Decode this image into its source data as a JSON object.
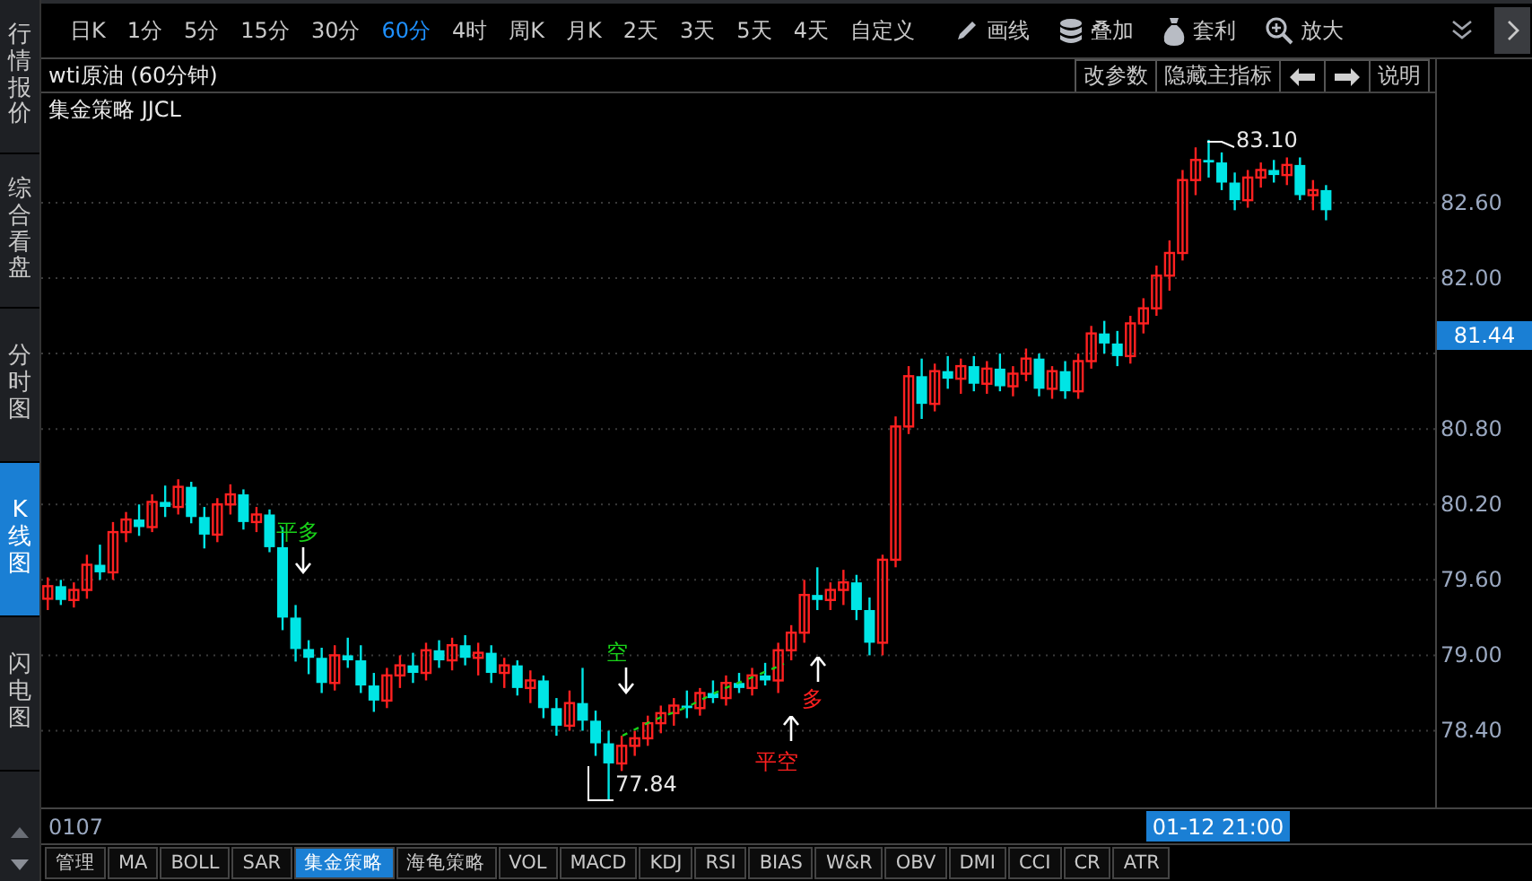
{
  "side_tabs": [
    {
      "label": "行情报价",
      "selected": false
    },
    {
      "label": "综合看盘",
      "selected": false
    },
    {
      "label": "分时图",
      "selected": false
    },
    {
      "label": "K线图",
      "selected": true
    },
    {
      "label": "闪电图",
      "selected": false
    }
  ],
  "periods": [
    {
      "label": "日K",
      "selected": false
    },
    {
      "label": "1分",
      "selected": false
    },
    {
      "label": "5分",
      "selected": false
    },
    {
      "label": "15分",
      "selected": false
    },
    {
      "label": "30分",
      "selected": false
    },
    {
      "label": "60分",
      "selected": true
    },
    {
      "label": "4时",
      "selected": false
    },
    {
      "label": "周K",
      "selected": false
    },
    {
      "label": "月K",
      "selected": false
    },
    {
      "label": "2天",
      "selected": false
    },
    {
      "label": "3天",
      "selected": false
    },
    {
      "label": "5天",
      "selected": false
    },
    {
      "label": "4天",
      "selected": false
    },
    {
      "label": "自定义",
      "selected": false
    }
  ],
  "tools": [
    {
      "label": "画线"
    },
    {
      "label": "叠加"
    },
    {
      "label": "套利"
    },
    {
      "label": "放大"
    }
  ],
  "chart": {
    "title": "wti原油 (60分钟)",
    "strategy": "集金策略 JJCL",
    "buttons": [
      {
        "kind": "text",
        "label": "改参数"
      },
      {
        "kind": "text",
        "label": "隐藏主指标"
      },
      {
        "kind": "prev"
      },
      {
        "kind": "next"
      },
      {
        "kind": "text",
        "label": "说明"
      }
    ],
    "current_price": "81.44",
    "high_label": "83.10",
    "low_label": "77.84",
    "signals": [
      {
        "label": "平多",
        "color": "#19d219"
      },
      {
        "label": "空",
        "color": "#19d219"
      },
      {
        "label": "多",
        "color": "#ff2020"
      },
      {
        "label": "平空",
        "color": "#ff2020"
      }
    ],
    "start_date": "0107",
    "cursor_time": "01-12 21:00",
    "chart_data": {
      "type": "candlestick",
      "grid": true,
      "ylim": [
        77.79,
        83.47
      ],
      "yticks": [
        {
          "value": 82.6,
          "label": "82.60"
        },
        {
          "value": 82.0,
          "label": "82.00"
        },
        {
          "value": 80.8,
          "label": "80.80"
        },
        {
          "value": 80.2,
          "label": "80.20"
        },
        {
          "value": 79.6,
          "label": "79.60"
        },
        {
          "value": 79.0,
          "label": "79.00"
        },
        {
          "value": 78.4,
          "label": "78.40"
        }
      ],
      "categories": [
        null,
        null,
        null,
        null,
        null,
        null,
        null,
        null,
        null,
        null,
        null,
        null,
        null,
        null,
        null,
        null,
        null,
        null,
        null,
        null,
        null,
        null,
        null,
        null,
        null,
        null,
        null,
        null,
        null,
        null,
        null,
        null,
        null,
        null,
        null,
        null,
        null,
        null,
        null,
        null,
        null,
        null,
        null,
        null,
        null,
        null,
        null,
        null,
        null,
        null,
        null,
        null,
        null,
        null,
        null,
        null,
        null,
        null,
        null,
        null,
        null,
        null,
        null,
        null,
        null,
        null,
        null,
        null,
        null,
        null,
        null,
        null,
        null,
        null,
        null,
        null,
        null,
        null,
        null,
        null,
        null,
        null,
        null,
        null,
        null,
        null,
        null,
        null,
        null,
        null,
        null,
        null,
        null,
        null,
        null,
        null,
        null,
        null,
        null,
        null,
        null,
        null,
        null,
        null,
        null,
        null,
        null
      ],
      "ohlc": [
        [
          79.45,
          79.62,
          79.36,
          79.55
        ],
        [
          79.55,
          79.6,
          79.4,
          79.44
        ],
        [
          79.44,
          79.58,
          79.38,
          79.52
        ],
        [
          79.52,
          79.8,
          79.45,
          79.72
        ],
        [
          79.72,
          79.88,
          79.6,
          79.66
        ],
        [
          79.66,
          80.06,
          79.6,
          79.98
        ],
        [
          79.98,
          80.14,
          79.9,
          80.08
        ],
        [
          80.08,
          80.2,
          79.95,
          80.02
        ],
        [
          80.02,
          80.28,
          79.98,
          80.22
        ],
        [
          80.22,
          80.35,
          80.1,
          80.18
        ],
        [
          80.18,
          80.4,
          80.12,
          80.34
        ],
        [
          80.34,
          80.38,
          80.05,
          80.1
        ],
        [
          80.1,
          80.18,
          79.85,
          79.96
        ],
        [
          79.96,
          80.25,
          79.9,
          80.2
        ],
        [
          80.2,
          80.36,
          80.12,
          80.28
        ],
        [
          80.28,
          80.32,
          80.0,
          80.06
        ],
        [
          80.06,
          80.18,
          79.98,
          80.12
        ],
        [
          80.12,
          80.16,
          79.82,
          79.86
        ],
        [
          79.86,
          80.02,
          79.2,
          79.3
        ],
        [
          79.3,
          79.4,
          78.95,
          79.05
        ],
        [
          79.05,
          79.12,
          78.85,
          78.98
        ],
        [
          78.98,
          79.06,
          78.7,
          78.78
        ],
        [
          78.78,
          79.08,
          78.72,
          79.0
        ],
        [
          79.0,
          79.14,
          78.9,
          78.96
        ],
        [
          78.96,
          79.08,
          78.7,
          78.76
        ],
        [
          78.76,
          78.86,
          78.55,
          78.64
        ],
        [
          78.64,
          78.9,
          78.58,
          78.84
        ],
        [
          78.84,
          79.0,
          78.74,
          78.92
        ],
        [
          78.92,
          79.02,
          78.78,
          78.86
        ],
        [
          78.86,
          79.1,
          78.8,
          79.04
        ],
        [
          79.04,
          79.12,
          78.9,
          78.96
        ],
        [
          78.96,
          79.14,
          78.88,
          79.08
        ],
        [
          79.08,
          79.16,
          78.92,
          78.98
        ],
        [
          78.98,
          79.1,
          78.84,
          79.02
        ],
        [
          79.02,
          79.08,
          78.78,
          78.86
        ],
        [
          78.86,
          78.98,
          78.74,
          78.92
        ],
        [
          78.92,
          78.96,
          78.68,
          78.74
        ],
        [
          78.74,
          78.88,
          78.62,
          78.8
        ],
        [
          78.8,
          78.84,
          78.5,
          78.58
        ],
        [
          78.58,
          78.66,
          78.36,
          78.44
        ],
        [
          78.44,
          78.72,
          78.4,
          78.62
        ],
        [
          78.62,
          78.9,
          78.4,
          78.48
        ],
        [
          78.48,
          78.56,
          78.2,
          78.3
        ],
        [
          78.3,
          78.4,
          77.84,
          78.14
        ],
        [
          78.14,
          78.36,
          78.08,
          78.28
        ],
        [
          78.28,
          78.4,
          78.2,
          78.34
        ],
        [
          78.34,
          78.52,
          78.28,
          78.46
        ],
        [
          78.46,
          78.6,
          78.38,
          78.54
        ],
        [
          78.54,
          78.66,
          78.44,
          78.6
        ],
        [
          78.6,
          78.72,
          78.5,
          78.58
        ],
        [
          78.58,
          78.74,
          78.52,
          78.7
        ],
        [
          78.7,
          78.8,
          78.62,
          78.66
        ],
        [
          78.66,
          78.84,
          78.6,
          78.78
        ],
        [
          78.78,
          78.86,
          78.7,
          78.74
        ],
        [
          78.74,
          78.9,
          78.68,
          78.84
        ],
        [
          78.84,
          78.94,
          78.76,
          78.8
        ],
        [
          78.8,
          79.1,
          78.7,
          79.04
        ],
        [
          79.04,
          79.24,
          78.96,
          79.18
        ],
        [
          79.18,
          79.6,
          79.1,
          79.48
        ],
        [
          79.48,
          79.7,
          79.36,
          79.44
        ],
        [
          79.44,
          79.58,
          79.36,
          79.52
        ],
        [
          79.52,
          79.68,
          79.4,
          79.58
        ],
        [
          79.58,
          79.64,
          79.28,
          79.36
        ],
        [
          79.36,
          79.46,
          79.0,
          79.1
        ],
        [
          79.1,
          79.8,
          79.0,
          79.76
        ],
        [
          79.76,
          80.9,
          79.7,
          80.82
        ],
        [
          80.82,
          81.3,
          80.76,
          81.22
        ],
        [
          81.22,
          81.36,
          80.88,
          81.0
        ],
        [
          81.0,
          81.32,
          80.94,
          81.26
        ],
        [
          81.26,
          81.38,
          81.12,
          81.2
        ],
        [
          81.2,
          81.36,
          81.08,
          81.3
        ],
        [
          81.3,
          81.38,
          81.1,
          81.16
        ],
        [
          81.16,
          81.34,
          81.08,
          81.28
        ],
        [
          81.28,
          81.4,
          81.1,
          81.14
        ],
        [
          81.14,
          81.3,
          81.06,
          81.24
        ],
        [
          81.24,
          81.44,
          81.18,
          81.36
        ],
        [
          81.36,
          81.4,
          81.06,
          81.12
        ],
        [
          81.12,
          81.3,
          81.04,
          81.26
        ],
        [
          81.26,
          81.34,
          81.04,
          81.1
        ],
        [
          81.1,
          81.4,
          81.04,
          81.34
        ],
        [
          81.34,
          81.62,
          81.28,
          81.56
        ],
        [
          81.56,
          81.66,
          81.4,
          81.48
        ],
        [
          81.48,
          81.58,
          81.3,
          81.38
        ],
        [
          81.38,
          81.7,
          81.32,
          81.64
        ],
        [
          81.64,
          81.84,
          81.56,
          81.76
        ],
        [
          81.76,
          82.1,
          81.7,
          82.02
        ],
        [
          82.02,
          82.3,
          81.9,
          82.2
        ],
        [
          82.2,
          82.86,
          82.14,
          82.78
        ],
        [
          82.78,
          83.04,
          82.66,
          82.94
        ],
        [
          82.94,
          83.1,
          82.8,
          82.92
        ],
        [
          82.92,
          83.0,
          82.7,
          82.76
        ],
        [
          82.76,
          82.84,
          82.54,
          82.62
        ],
        [
          82.62,
          82.86,
          82.56,
          82.8
        ],
        [
          82.8,
          82.92,
          82.72,
          82.86
        ],
        [
          82.86,
          82.94,
          82.76,
          82.82
        ],
        [
          82.82,
          82.96,
          82.74,
          82.9
        ],
        [
          82.9,
          82.96,
          82.62,
          82.66
        ],
        [
          82.66,
          82.78,
          82.54,
          82.7
        ],
        [
          82.7,
          82.74,
          82.46,
          82.54
        ],
        null,
        null,
        null,
        null,
        null,
        null,
        null,
        null
      ]
    }
  },
  "indicator_tabs": [
    {
      "label": "管理",
      "selected": false
    },
    {
      "label": "MA",
      "selected": false
    },
    {
      "label": "BOLL",
      "selected": false
    },
    {
      "label": "SAR",
      "selected": false
    },
    {
      "label": "集金策略",
      "selected": true
    },
    {
      "label": "海龟策略",
      "selected": false
    },
    {
      "label": "VOL",
      "selected": false
    },
    {
      "label": "MACD",
      "selected": false
    },
    {
      "label": "KDJ",
      "selected": false
    },
    {
      "label": "RSI",
      "selected": false
    },
    {
      "label": "BIAS",
      "selected": false
    },
    {
      "label": "W&R",
      "selected": false
    },
    {
      "label": "OBV",
      "selected": false
    },
    {
      "label": "DMI",
      "selected": false
    },
    {
      "label": "CCI",
      "selected": false
    },
    {
      "label": "CR",
      "selected": false
    },
    {
      "label": "ATR",
      "selected": false
    }
  ]
}
